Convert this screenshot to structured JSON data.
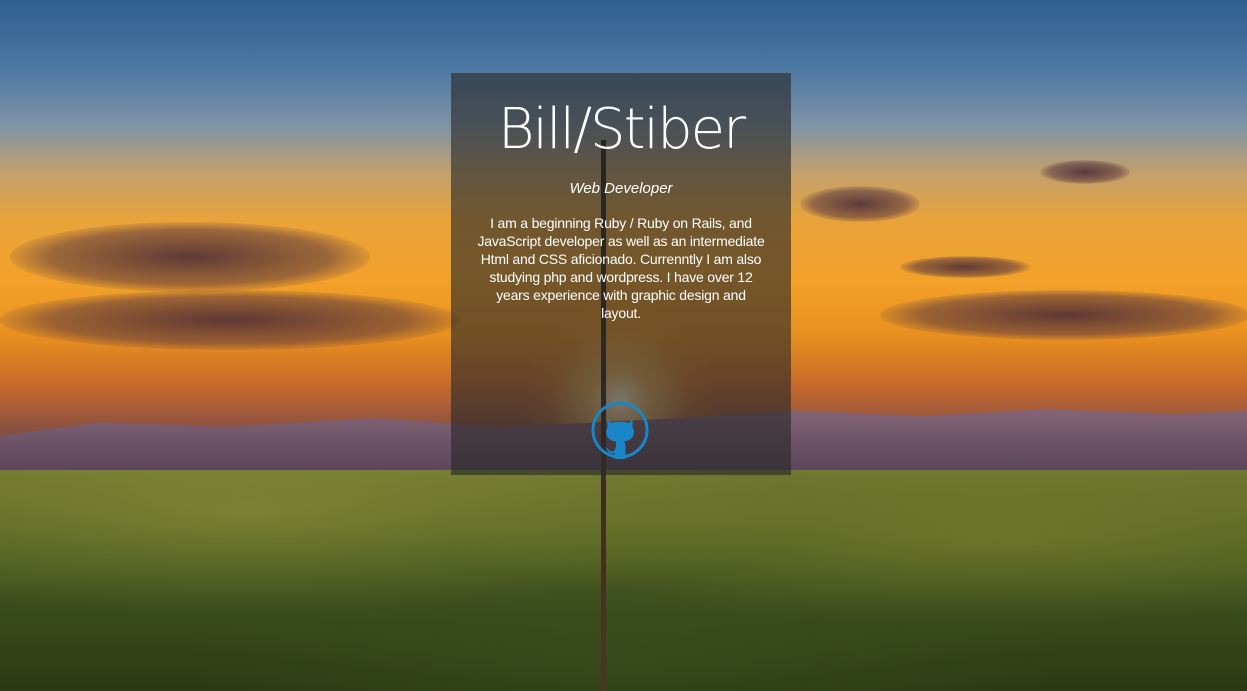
{
  "profile": {
    "name": "Bill/Stiber",
    "title": "Web Developer",
    "bio": "I am a beginning Ruby / Ruby on Rails, and JavaScript developer as well as an intermediate Html and CSS aficionado. Currenntly I am also studying php and wordpress. I have over 12 years experience with graphic design and layout."
  },
  "links": {
    "github_icon": "github-octocat-icon",
    "accent_color": "#1a86c8"
  },
  "colors": {
    "card_background": "rgba(40,40,40,0.62)",
    "text": "#ffffff"
  }
}
